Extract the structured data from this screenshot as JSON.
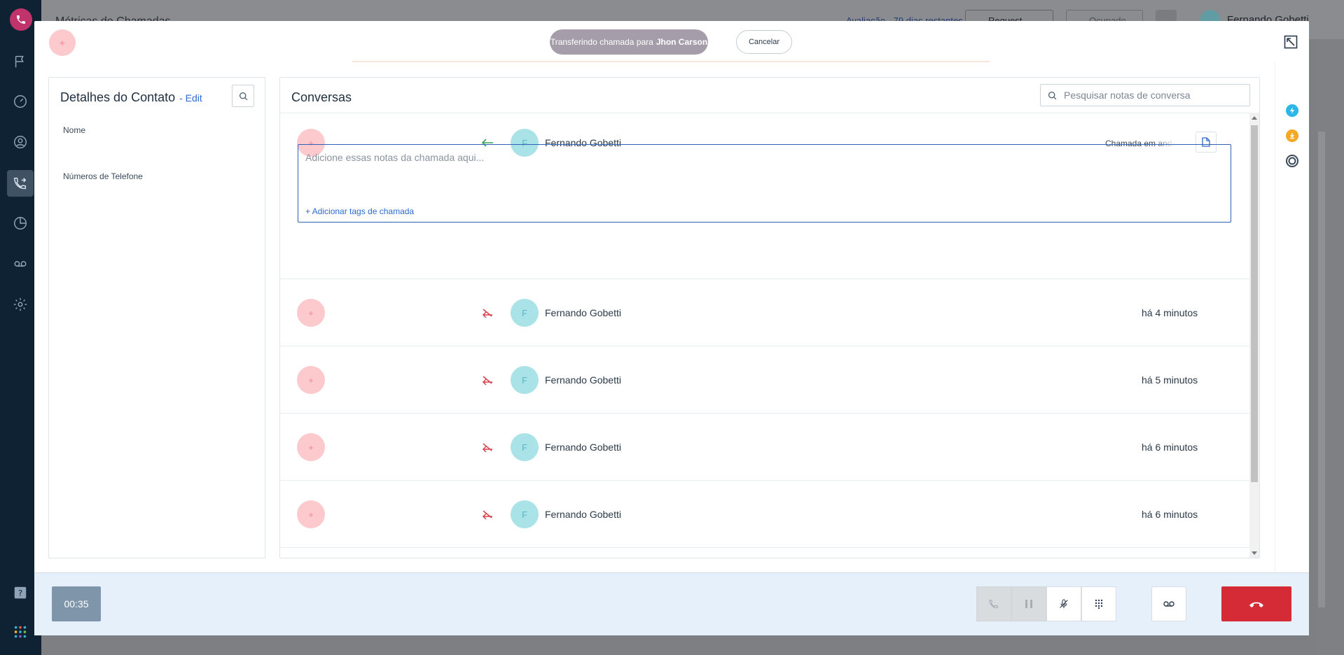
{
  "background": {
    "page_title": "Métricas de Chamadas",
    "trial_text": "Avaliação - 79 dias restantes",
    "request_demo_label": "Request Demo",
    "status_label": "Ocupado",
    "user_name": "Fernando Gobetti"
  },
  "transfer_bar": {
    "prefix": "Transferindo chamada para",
    "target": "Jhon Carson",
    "cancel_label": "Cancelar",
    "avatar_initial": "+"
  },
  "contact": {
    "title": "Detalhes do Contato",
    "edit_label": "- Edit",
    "fields": [
      {
        "label": "Nome"
      },
      {
        "label": "Números de Telefone"
      }
    ]
  },
  "conversations": {
    "title": "Conversas",
    "search_placeholder": "Pesquisar notas de conversa",
    "current": {
      "initial": "+",
      "avatar_initial": "F",
      "caller": "Fernando Gobetti",
      "status": "Chamada em andamento",
      "notes_placeholder": "Adicione essas notas da chamada aqui...",
      "add_tags_label": "+ Adicionar tags de chamada"
    },
    "history": [
      {
        "initial": "+",
        "avatar_initial": "F",
        "caller": "Fernando Gobetti",
        "time": "há 4 minutos"
      },
      {
        "initial": "+",
        "avatar_initial": "F",
        "caller": "Fernando Gobetti",
        "time": "há 5 minutos"
      },
      {
        "initial": "+",
        "avatar_initial": "F",
        "caller": "Fernando Gobetti",
        "time": "há 6 minutos"
      },
      {
        "initial": "+",
        "avatar_initial": "F",
        "caller": "Fernando Gobetti",
        "time": "há 6 minutos"
      }
    ]
  },
  "callbar": {
    "timer": "00:35"
  },
  "colors": {
    "brand_pink": "#c0336b",
    "accent_blue": "#2d6bd0",
    "hangup_red": "#d52b36",
    "incoming_green": "#3aa655",
    "missed_red": "#d9434b"
  }
}
